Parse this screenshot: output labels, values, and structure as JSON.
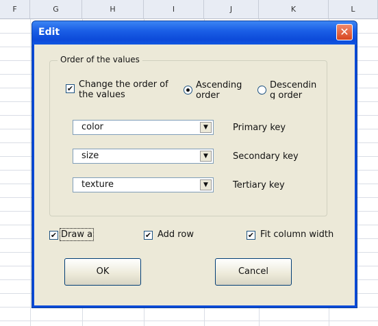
{
  "sheet": {
    "columns": [
      "F",
      "G",
      "H",
      "I",
      "J",
      "K",
      "L"
    ]
  },
  "dialog": {
    "title": "Edit",
    "close_glyph": "✕",
    "group_title": "Order of the values",
    "change_order_label": "Change the order of the values",
    "change_order_checked": true,
    "ascending_label": "Ascending order",
    "descending_label": "Descending order",
    "sort_direction": "ascending",
    "keys": [
      {
        "value": "color",
        "label": "Primary key"
      },
      {
        "value": "size",
        "label": "Secondary key"
      },
      {
        "value": "texture",
        "label": "Tertiary key"
      }
    ],
    "draw_label": "Draw a",
    "add_row_label": "Add row",
    "fit_width_label": "Fit column width",
    "draw_checked": true,
    "add_row_checked": true,
    "fit_width_checked": true,
    "ok_label": "OK",
    "cancel_label": "Cancel",
    "arrow_glyph": "▼",
    "check_glyph": "✔"
  }
}
